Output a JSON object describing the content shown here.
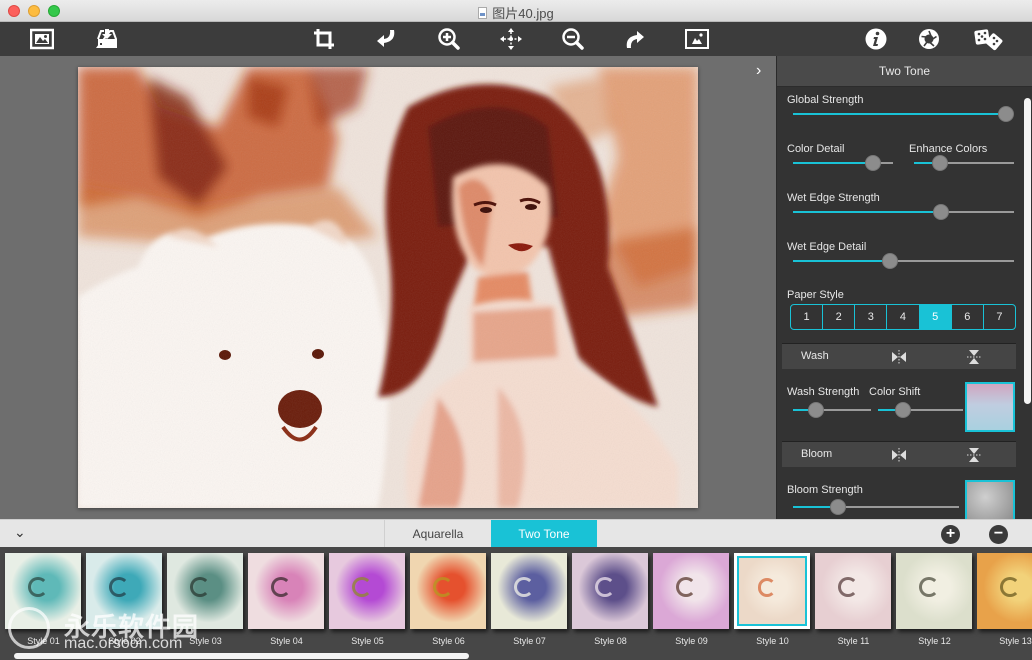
{
  "window": {
    "title": "图片40.jpg"
  },
  "toolbar": {
    "buttons": [
      {
        "name": "open-image",
        "icon": "image-icon"
      },
      {
        "name": "save",
        "icon": "download-tray-icon"
      },
      {
        "name": "crop",
        "icon": "crop-icon"
      },
      {
        "name": "undo",
        "icon": "undo-arrow-icon"
      },
      {
        "name": "zoom-in",
        "icon": "zoom-in-icon"
      },
      {
        "name": "pan",
        "icon": "move-arrows-icon"
      },
      {
        "name": "zoom-out",
        "icon": "zoom-out-icon"
      },
      {
        "name": "redo",
        "icon": "redo-arrow-icon"
      },
      {
        "name": "compare",
        "icon": "image-frame-icon"
      },
      {
        "name": "info",
        "icon": "info-icon"
      },
      {
        "name": "settings",
        "icon": "aperture-icon"
      },
      {
        "name": "random",
        "icon": "dice-icon"
      }
    ]
  },
  "panel": {
    "title": "Two Tone",
    "sliders": {
      "global_strength": {
        "label": "Global Strength",
        "value": 99
      },
      "color_detail": {
        "label": "Color Detail",
        "value": 80
      },
      "enhance_colors": {
        "label": "Enhance Colors",
        "value": 26
      },
      "wet_edge_strength": {
        "label": "Wet Edge Strength",
        "value": 67
      },
      "wet_edge_detail": {
        "label": "Wet Edge Detail",
        "value": 44
      },
      "wash_strength": {
        "label": "Wash Strength",
        "value": 30
      },
      "color_shift": {
        "label": "Color Shift",
        "value": 29
      },
      "bloom_strength": {
        "label": "Bloom Strength",
        "value": 27
      }
    },
    "paper_style": {
      "label": "Paper Style",
      "options": [
        "1",
        "2",
        "3",
        "4",
        "5",
        "6",
        "7"
      ],
      "selected": "5"
    },
    "sections": {
      "wash": "Wash",
      "bloom": "Bloom"
    }
  },
  "bottom": {
    "tabs": [
      {
        "label": "Aquarella",
        "active": false
      },
      {
        "label": "Two Tone",
        "active": true
      }
    ],
    "add_label": "+",
    "remove_label": "−"
  },
  "styles": [
    {
      "label": "Style 01",
      "theme": "portrait-cyan"
    },
    {
      "label": "Style 02",
      "theme": "portrait-teal"
    },
    {
      "label": "Style 03",
      "theme": "portrait-green"
    },
    {
      "label": "Style 04",
      "theme": "portrait-pink"
    },
    {
      "label": "Style 05",
      "theme": "flowers-purple"
    },
    {
      "label": "Style 06",
      "theme": "flowers-orange"
    },
    {
      "label": "Style 07",
      "theme": "flowers-blue"
    },
    {
      "label": "Style 08",
      "theme": "flowers-violet"
    },
    {
      "label": "Style 09",
      "theme": "orchid-pink"
    },
    {
      "label": "Style 10",
      "theme": "orchid-peach",
      "selected": true
    },
    {
      "label": "Style 11",
      "theme": "orchid-rose"
    },
    {
      "label": "Style 12",
      "theme": "orchid-cream"
    },
    {
      "label": "Style 13",
      "theme": "ship-orange"
    }
  ],
  "watermark": {
    "text": "永乐软件园",
    "url": "mac.orsoon.com"
  },
  "colors": {
    "accent": "#19c2d6",
    "toolbar_bg": "#3c3c3c",
    "panel_bg": "#333333"
  }
}
